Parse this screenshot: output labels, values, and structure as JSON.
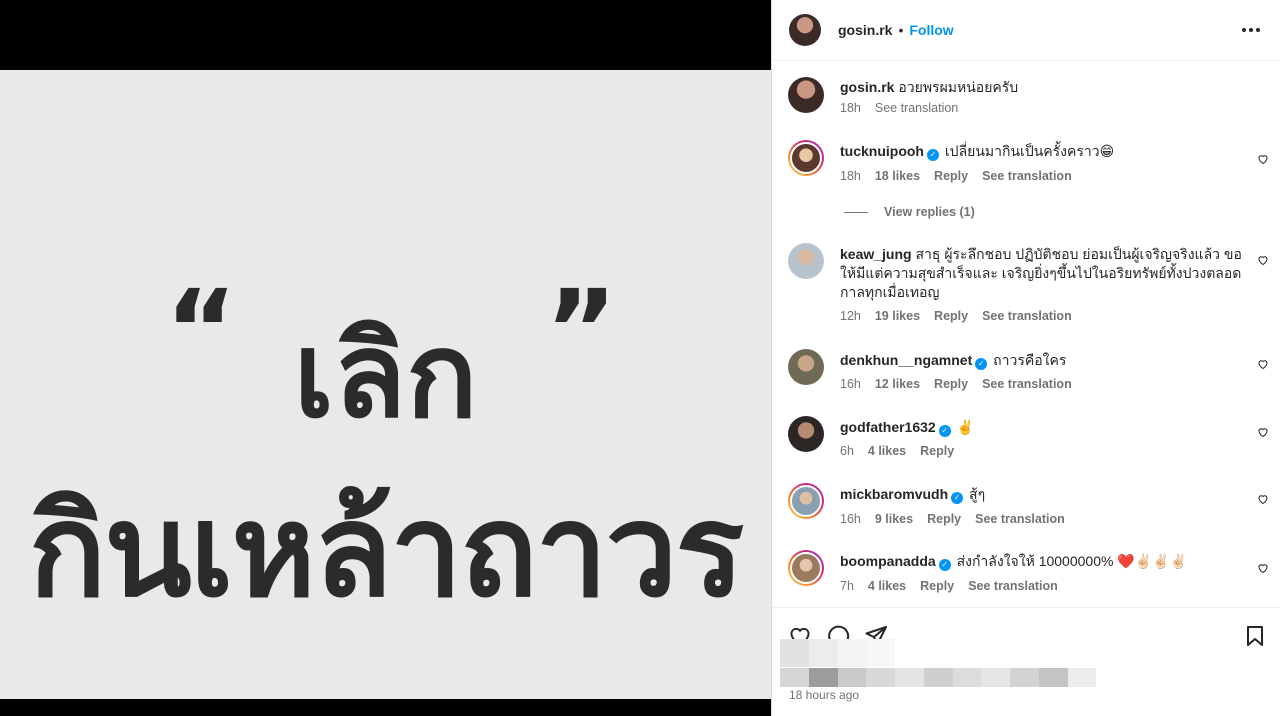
{
  "media": {
    "quote_open": "“",
    "quote_close": "”",
    "line1": "เลิก",
    "line2": "กินเหล้าถาวร",
    "background": "#e9e9e9",
    "text_color": "#2b2b2b"
  },
  "header": {
    "username": "gosin.rk",
    "separator": "•",
    "follow_label": "Follow",
    "more_icon": "more-horizontal-icon"
  },
  "caption": {
    "username": "gosin.rk",
    "text": "อวยพรผมหน่อยครับ",
    "time": "18h",
    "see_translation": "See translation"
  },
  "comments": [
    {
      "username": "tucknuipooh",
      "verified": true,
      "text": "เปลี่ยนมากินเป็นครั้งคราว😁",
      "time": "18h",
      "likes": "18 likes",
      "reply": "Reply",
      "see_translation": "See translation",
      "view_replies": "View replies (1)"
    },
    {
      "username": "keaw_jung",
      "verified": false,
      "text": "สาธุ ผู้ระลึกชอบ ปฏิบัติชอบ ย่อมเป็นผู้เจริญจริงแล้ว ขอให้มีแต่ความสุขสำเร็จและ เจริญยิ่งๆขึ้นไปในอริยทรัพย์ทั้งปวงตลอดกาลทุกเมื่อเทอญ",
      "time": "12h",
      "likes": "19 likes",
      "reply": "Reply",
      "see_translation": "See translation"
    },
    {
      "username": "denkhun__ngamnet",
      "verified": true,
      "text": "ถาวรคือใคร",
      "time": "16h",
      "likes": "12 likes",
      "reply": "Reply",
      "see_translation": "See translation"
    },
    {
      "username": "godfather1632",
      "verified": true,
      "text": "✌️",
      "time": "6h",
      "likes": "4 likes",
      "reply": "Reply"
    },
    {
      "username": "mickbaromvudh",
      "verified": true,
      "text": "สู้ๆ",
      "time": "16h",
      "likes": "9 likes",
      "reply": "Reply",
      "see_translation": "See translation"
    },
    {
      "username": "boompanadda",
      "verified": true,
      "text": "ส่งกำลังใจให้ 10000000% ❤️✌🏻✌🏻✌🏻",
      "time": "7h",
      "likes": "4 likes",
      "reply": "Reply",
      "see_translation": "See translation"
    }
  ],
  "actions": {
    "like_icon": "heart-icon",
    "comment_icon": "comment-icon",
    "share_icon": "send-icon",
    "save_icon": "bookmark-icon",
    "timestamp": "18 hours ago"
  },
  "colors": {
    "accent": "#0095f6",
    "muted": "#737373",
    "text": "#262626"
  }
}
